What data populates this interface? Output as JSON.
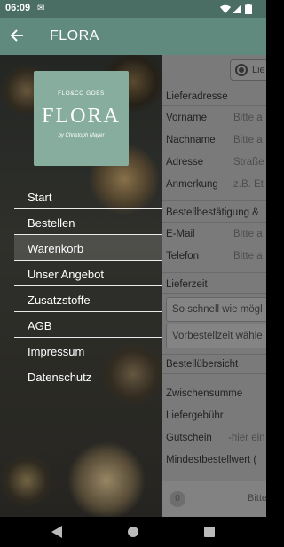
{
  "status_bar": {
    "time": "06:09",
    "notification_icon": "chat-bubble-icon",
    "icons": [
      "wifi-icon",
      "signal-icon",
      "battery-icon"
    ]
  },
  "app_bar": {
    "title": "FLORA",
    "back_icon": "arrow-left-icon"
  },
  "drawer": {
    "logo": {
      "top": "FLO&CO GOES",
      "word": "FLORA",
      "signature": "by Christoph Mayer"
    },
    "items": [
      {
        "label": "Start"
      },
      {
        "label": "Bestellen"
      },
      {
        "label": "Warenkorb"
      },
      {
        "label": "Unser Angebot"
      },
      {
        "label": "Zusatzstoffe"
      },
      {
        "label": "AGB"
      },
      {
        "label": "Impressum"
      },
      {
        "label": "Datenschutz"
      }
    ]
  },
  "form": {
    "delivery_option": "Lie",
    "section_address": "Lieferadresse",
    "fields": [
      {
        "label": "Vorname",
        "placeholder": "Bitte a"
      },
      {
        "label": "Nachname",
        "placeholder": "Bitte a"
      },
      {
        "label": "Adresse",
        "placeholder": "Straße"
      },
      {
        "label": "Anmerkung",
        "placeholder": "z.B. Et"
      }
    ],
    "section_confirm": "Bestellbestätigung &",
    "confirm_fields": [
      {
        "label": "E-Mail",
        "placeholder": "Bitte a"
      },
      {
        "label": "Telefon",
        "placeholder": "Bitte a"
      }
    ],
    "section_time": "Lieferzeit",
    "time_options": [
      "So schnell wie mögl",
      "Vorbestellzeit wähle"
    ],
    "section_overview": "Bestellübersicht",
    "subtotal": "Zwischensumme",
    "delivery_fee": "Liefergebühr",
    "voucher_label": "Gutschein",
    "voucher_placeholder": "-hier ein",
    "min_order": "Mindestbestellwert (",
    "cart_count": "0",
    "bottom_text": "Bitte"
  },
  "colors": {
    "status_bar": "#4a6e63",
    "app_bar": "#5f8a7d",
    "logo": "#86ad9d"
  }
}
